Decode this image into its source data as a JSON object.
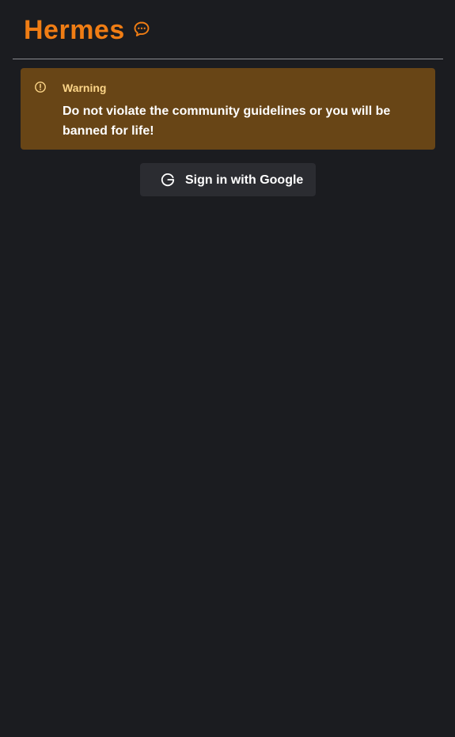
{
  "header": {
    "title": "Hermes",
    "icon": "chat-bubble-icon",
    "accent_color": "#f07d14"
  },
  "alert": {
    "icon": "exclamation-circle-icon",
    "title": "Warning",
    "message": "Do not violate the community guidelines or you will be banned for life!",
    "background_color": "#684516",
    "title_color": "#fcd588"
  },
  "auth": {
    "icon": "google-g-icon",
    "button_label": "Sign in with Google"
  },
  "colors": {
    "page_background": "#1b1c20",
    "button_background": "#2b2c31"
  }
}
